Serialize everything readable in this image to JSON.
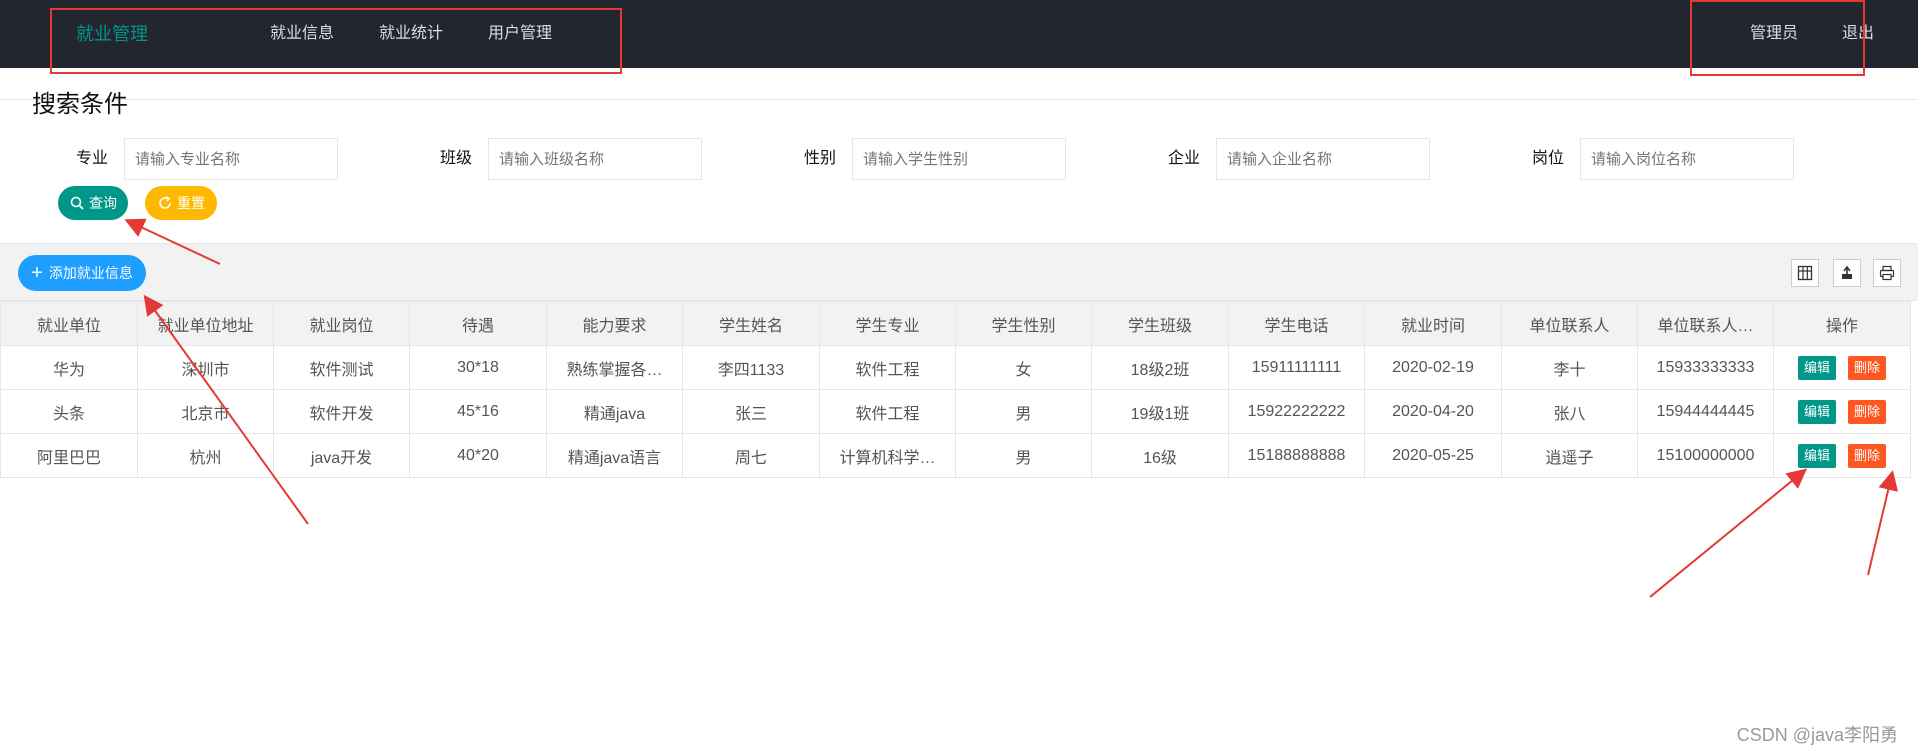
{
  "header": {
    "brand": "就业管理",
    "nav": [
      {
        "label": "就业信息"
      },
      {
        "label": "就业统计"
      },
      {
        "label": "用户管理"
      }
    ],
    "user": "管理员",
    "logout": "退出"
  },
  "search": {
    "title": "搜索条件",
    "fields": [
      {
        "label": "专业",
        "placeholder": "请输入专业名称",
        "value": ""
      },
      {
        "label": "班级",
        "placeholder": "请输入班级名称",
        "value": ""
      },
      {
        "label": "性别",
        "placeholder": "请输入学生性别",
        "value": ""
      },
      {
        "label": "企业",
        "placeholder": "请输入企业名称",
        "value": ""
      },
      {
        "label": "岗位",
        "placeholder": "请输入岗位名称",
        "value": ""
      }
    ],
    "query_label": "查询",
    "reset_label": "重置"
  },
  "toolbar": {
    "add_label": "添加就业信息",
    "icons": [
      "columns-icon",
      "export-icon",
      "print-icon"
    ]
  },
  "table": {
    "columns": [
      "就业单位",
      "就业单位地址",
      "就业岗位",
      "待遇",
      "能力要求",
      "学生姓名",
      "学生专业",
      "学生性别",
      "学生班级",
      "学生电话",
      "就业时间",
      "单位联系人",
      "单位联系人…",
      "操作"
    ],
    "rows": [
      [
        "华为",
        "深圳市",
        "软件测试",
        "30*18",
        "熟练掌握各…",
        "李四1133",
        "软件工程",
        "女",
        "18级2班",
        "15911111111",
        "2020-02-19",
        "李十",
        "15933333333"
      ],
      [
        "头条",
        "北京市",
        "软件开发",
        "45*16",
        "精通java",
        "张三",
        "软件工程",
        "男",
        "19级1班",
        "15922222222",
        "2020-04-20",
        "张八",
        "15944444445"
      ],
      [
        "阿里巴巴",
        "杭州",
        "java开发",
        "40*20",
        "精通java语言",
        "周七",
        "计算机科学…",
        "男",
        "16级",
        "15188888888",
        "2020-05-25",
        "逍遥子",
        "15100000000"
      ]
    ],
    "edit_label": "编辑",
    "delete_label": "删除"
  },
  "colors": {
    "header_bg": "#23262e",
    "brand": "#009688",
    "query_btn": "#009688",
    "reset_btn": "#ffb800",
    "add_btn": "#1e9fff",
    "edit_btn": "#009688",
    "delete_btn": "#ff5722",
    "annotation": "#e53935"
  },
  "watermark": "CSDN @java李阳勇"
}
